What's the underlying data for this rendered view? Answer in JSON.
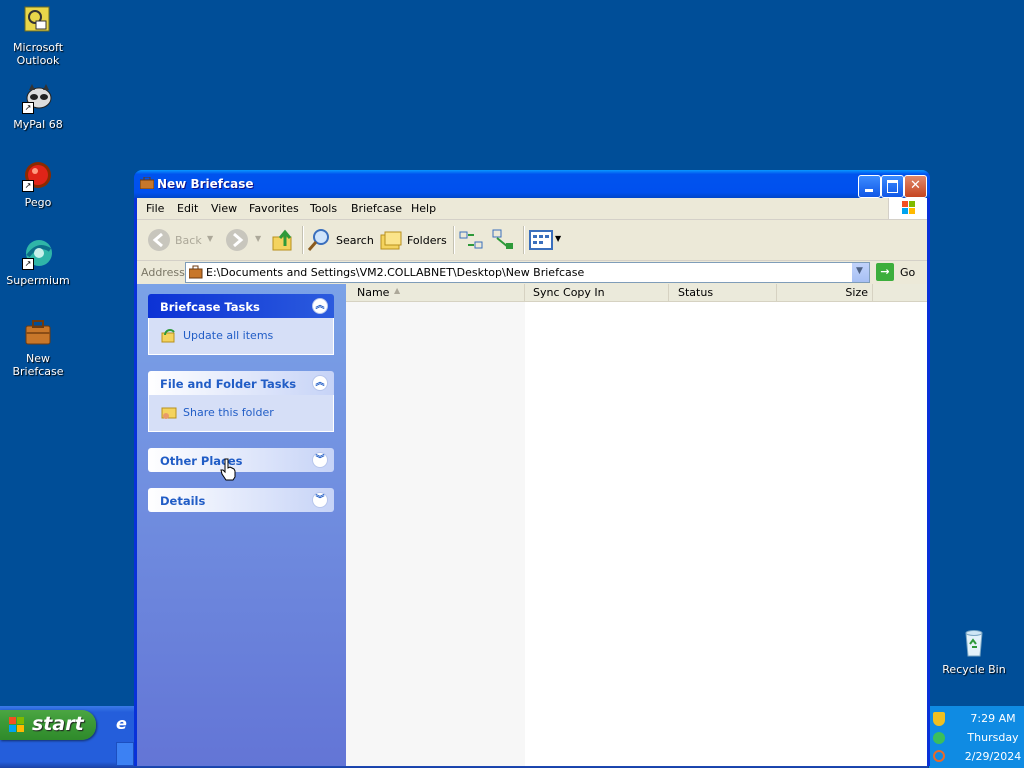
{
  "desktop": {
    "icons": [
      {
        "label": "Microsoft\nOutlook",
        "line1": "Microsoft",
        "line2": "Outlook"
      },
      {
        "label": "MyPal 68"
      },
      {
        "label": "Pego"
      },
      {
        "label": "Supermium"
      },
      {
        "label": "New Briefcase"
      },
      {
        "label": "Recycle Bin"
      }
    ]
  },
  "taskbar": {
    "start_label": "start",
    "clock": {
      "time": "7:29 AM",
      "day": "Thursday",
      "date": "2/29/2024"
    }
  },
  "window": {
    "title": "New Briefcase",
    "menu": [
      "File",
      "Edit",
      "View",
      "Favorites",
      "Tools",
      "Briefcase",
      "Help"
    ],
    "toolbar": {
      "back": "Back",
      "search": "Search",
      "folders": "Folders"
    },
    "address": {
      "label": "Address",
      "path": "E:\\Documents and Settings\\VM2.COLLABNET\\Desktop\\New Briefcase",
      "go": "Go"
    },
    "taskpane": {
      "briefcase_tasks": {
        "title": "Briefcase Tasks",
        "link": "Update all items"
      },
      "file_folder_tasks": {
        "title": "File and Folder Tasks",
        "link": "Share this folder"
      },
      "other_places": {
        "title": "Other Places"
      },
      "details": {
        "title": "Details"
      }
    },
    "columns": [
      "Name",
      "Sync Copy In",
      "Status",
      "Size"
    ]
  },
  "colors": {
    "desktop": "#004e98",
    "title_blue": "#0050ee",
    "taskpane": "#7ba2e7",
    "start_green": "#3c9a37"
  }
}
